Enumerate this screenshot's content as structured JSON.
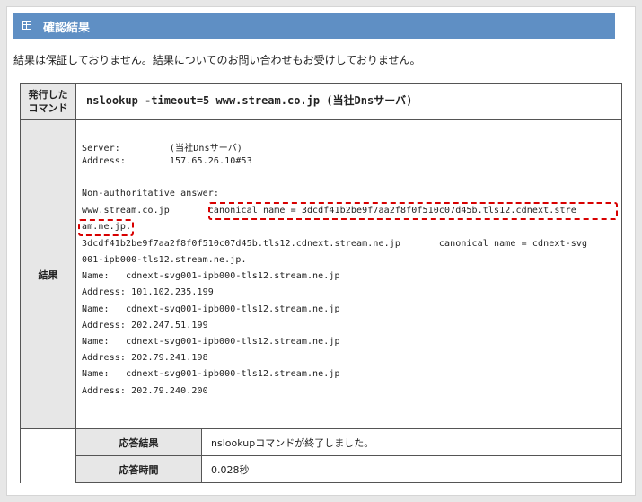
{
  "header": {
    "title": "確認結果",
    "icon": "grid-icon"
  },
  "disclaimer": "結果は保証しておりません。結果についてのお問い合わせもお受けしておりません。",
  "table": {
    "command_label_line1": "発行した",
    "command_label_line2": "コマンド",
    "command": "nslookup -timeout=5 www.stream.co.jp (当社Dnsサーバ)",
    "result_label": "結果",
    "result_lines": [
      "Server:         (当社Dnsサーバ)",
      "Address:        157.65.26.10#53",
      "",
      "Non-authoritative answer:",
      "www.stream.co.jp       canonical name = 3dcdf41b2be9f7aa2f8f0f510c07d45b.tls12.cdnext.stre",
      "am.ne.jp.",
      "3dcdf41b2be9f7aa2f8f0f510c07d45b.tls12.cdnext.stream.ne.jp       canonical name = cdnext-svg",
      "001-ipb000-tls12.stream.ne.jp.",
      "Name:   cdnext-svg001-ipb000-tls12.stream.ne.jp",
      "Address: 101.102.235.199",
      "Name:   cdnext-svg001-ipb000-tls12.stream.ne.jp",
      "Address: 202.247.51.199",
      "Name:   cdnext-svg001-ipb000-tls12.stream.ne.jp",
      "Address: 202.79.241.198",
      "Name:   cdnext-svg001-ipb000-tls12.stream.ne.jp",
      "Address: 202.79.240.200"
    ],
    "response_result_label": "応答結果",
    "response_result_value": "nslookupコマンドが終了しました。",
    "response_time_label": "応答時間",
    "response_time_value": "0.028秒"
  },
  "colors": {
    "header_bg": "#5f8fc4",
    "label_bg": "#e7e7e7",
    "highlight": "#d80000"
  }
}
